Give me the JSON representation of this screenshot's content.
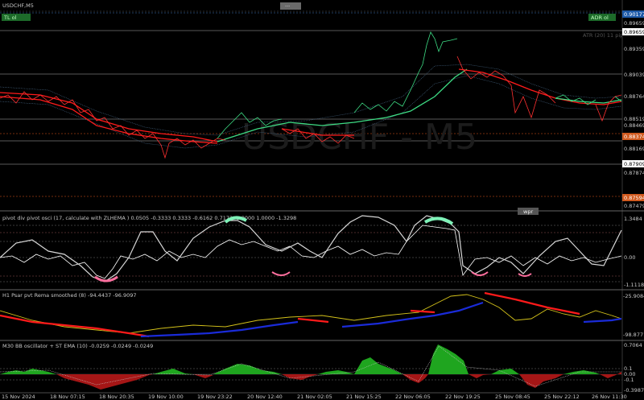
{
  "window": {
    "symbol_label": "USDCHF,M5",
    "center_tab_label": "···",
    "badge_left": "TL ol",
    "badge_right": "ADR ol",
    "watermark": "USDCHF - M5",
    "atr_label": "ATR (20) 11 pips",
    "wpr_tab": "wpr"
  },
  "price_axis": {
    "labels": [
      "0.89659",
      "0.89359",
      "0.89039",
      "0.88764",
      "0.88519",
      "0.88469",
      "0.88169",
      "0.87909",
      "0.87874",
      "0.87479"
    ],
    "boxes": [
      {
        "value": "0.90177",
        "bg": "#1e5aa8",
        "fg": "#ffffff"
      },
      {
        "value": "0.89659",
        "bg": "#ffffff",
        "fg": "#000000"
      },
      {
        "value": "0.88374",
        "bg": "#d05a1f",
        "fg": "#ffffff"
      },
      {
        "value": "0.87909",
        "bg": "#ffffff",
        "fg": "#000000"
      },
      {
        "value": "0.87594",
        "bg": "#d05a1f",
        "fg": "#ffffff"
      }
    ]
  },
  "pivot_panel": {
    "title": "pivot div pivot osci (17, calculate with  ZLHEMA  ) 0.0505 -0.3333 0.3333 -0.6162 0.7172 -1.0000 1.0000 -1.3298",
    "axis": [
      "1.3484",
      "0.00",
      "-1.1118"
    ]
  },
  "psar_panel": {
    "title": "H1 Psar pvt Rema smoothed (8) -94.4437 -96.9097",
    "axis": [
      "-25.9084",
      "-98.8771"
    ]
  },
  "bb_panel": {
    "title": "M30 BB oscillator + ST EMA (10) -0.0259 -0.0249 -0.0249",
    "axis": [
      "0.7064",
      "0.1",
      "0.00",
      "-0.1",
      "-0.3987"
    ]
  },
  "time_axis": [
    "15 Nov 2024",
    "18 Nov 07:15",
    "18 Nov 20:35",
    "19 Nov 10:00",
    "19 Nov 23:22",
    "20 Nov 12:40",
    "21 Nov 02:05",
    "21 Nov 15:25",
    "22 Nov 06:05",
    "22 Nov 19:25",
    "25 Nov 08:45",
    "25 Nov 22:12",
    "26 Nov 11:30"
  ],
  "colors": {
    "background": "#000000",
    "bear_line": "#ff1a1a",
    "bull_line": "#3ddc84",
    "oscillator_line": "#e6e6e6",
    "psar_bear": "#ff1a1a",
    "psar_bull": "#1a2bd8",
    "psar_signal": "#d4c21a",
    "bb_up": "#1fa51f",
    "bb_down": "#a51616"
  }
}
